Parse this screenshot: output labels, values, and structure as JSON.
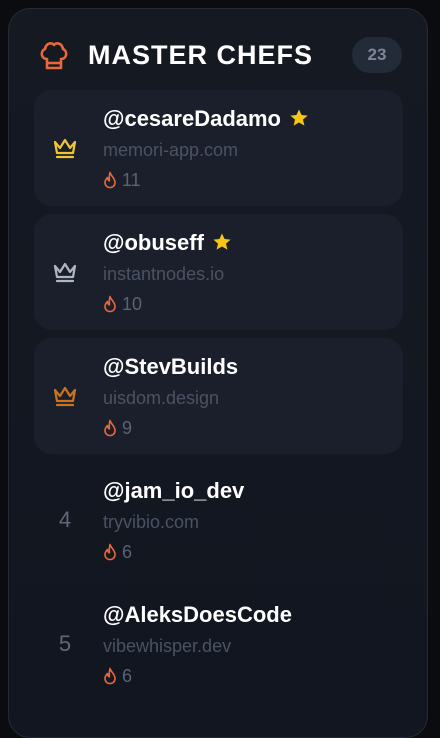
{
  "leaderboard": {
    "title": "MASTER CHEFS",
    "count": "23",
    "colors": {
      "accent": "#e8683a",
      "gold": "#f0c437",
      "silver": "#aeb6c4",
      "bronze": "#c9721f"
    },
    "entries": [
      {
        "rank_icon": "gold-crown-icon",
        "handle": "@cesareDadamo",
        "verified": true,
        "domain": "memori-app.com",
        "fires": "11"
      },
      {
        "rank_icon": "silver-crown-icon",
        "handle": "@obuseff",
        "verified": true,
        "domain": "instantnodes.io",
        "fires": "10"
      },
      {
        "rank_icon": "bronze-crown-icon",
        "handle": "@StevBuilds",
        "verified": false,
        "domain": "uisdom.design",
        "fires": "9"
      },
      {
        "rank": "4",
        "handle": "@jam_io_dev",
        "verified": false,
        "domain": "tryvibio.com",
        "fires": "6"
      },
      {
        "rank": "5",
        "handle": "@AleksDoesCode",
        "verified": false,
        "domain": "vibewhisper.dev",
        "fires": "6"
      }
    ]
  }
}
